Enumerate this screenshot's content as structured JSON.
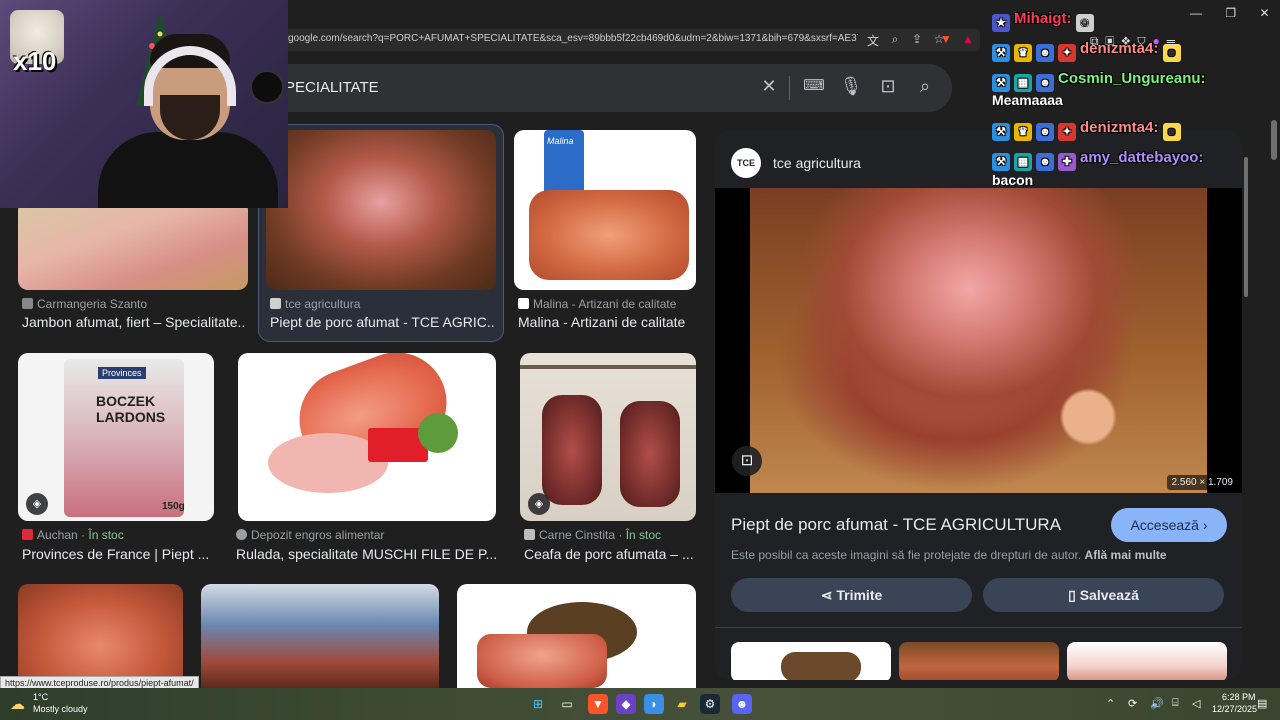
{
  "browser": {
    "url": "google.com/search?q=PORC+AFUMAT+SPECIALITATE&sca_esv=89bbb5f22cb469d0&udm=2&biw=1371&bih=679&sxsrf=AE3TifNFlgpM...",
    "status_url": "https://www.tceproduse.ro/produs/piept-afumat/"
  },
  "search": {
    "query_visible": "PECIALITATE"
  },
  "results": [
    {
      "source": "Carmangeria Szanto",
      "title": "Jambon afumat, fiert – Specialitate...",
      "stock": ""
    },
    {
      "source": "tce agricultura",
      "title": "Piept de porc afumat - TCE AGRIC...",
      "stock": ""
    },
    {
      "source": "Malina - Artizani de calitate",
      "title": "Malina - Artizani de calitate",
      "stock": ""
    },
    {
      "source": "Auchan",
      "title": "Provinces de France | Piept ...",
      "stock": "În stoc"
    },
    {
      "source": "Depozit engros alimentar",
      "title": "Rulada, specialitate MUSCHI FILE DE P...",
      "stock": ""
    },
    {
      "source": "Carne Cinstita",
      "title": "Ceafa de porc afumata – ...",
      "stock": "În stoc"
    }
  ],
  "product_overlays": {
    "malina_brand": "Malina",
    "provinces_brand": "Provinces",
    "boczek": "BOCZEK",
    "lardons": "LARDONS",
    "weight": "150g"
  },
  "preview": {
    "avatar": "TCE",
    "source": "tce agricultura",
    "dimensions": "2.560 × 1.709",
    "title": "Piept de porc afumat - TCE AGRICULTURA",
    "visit_label": "Accesează",
    "copyright": "Este posibil ca aceste imagini să fie protejate de drepturi de autor.",
    "learn_more": "Află mai multe",
    "share_label": "Trimite",
    "save_label": "Salvează"
  },
  "stream": {
    "multiplier": "x10",
    "chat": [
      {
        "user": "Mihaigt:",
        "color": "#ff3b5c",
        "message": ""
      },
      {
        "user": "denizmta4:",
        "color": "#ff8a8a",
        "message": ""
      },
      {
        "user": "Cosmin_Ungureanu:",
        "color": "#7cf37c",
        "message": "Meamaaaa"
      },
      {
        "user": "denizmta4:",
        "color": "#ff8a8a",
        "message": ""
      },
      {
        "user": "amy_dattebayoo:",
        "color": "#b28cff",
        "message": "bacon"
      }
    ]
  },
  "taskbar": {
    "temperature": "1°C",
    "weather": "Mostly cloudy",
    "time": "6:28 PM",
    "date": "12/27/2025"
  },
  "colors": {
    "accent": "#8ab4f8",
    "in_stock": "#81c995",
    "panel_bg": "#202124",
    "page_bg": "#1f1f1f"
  }
}
